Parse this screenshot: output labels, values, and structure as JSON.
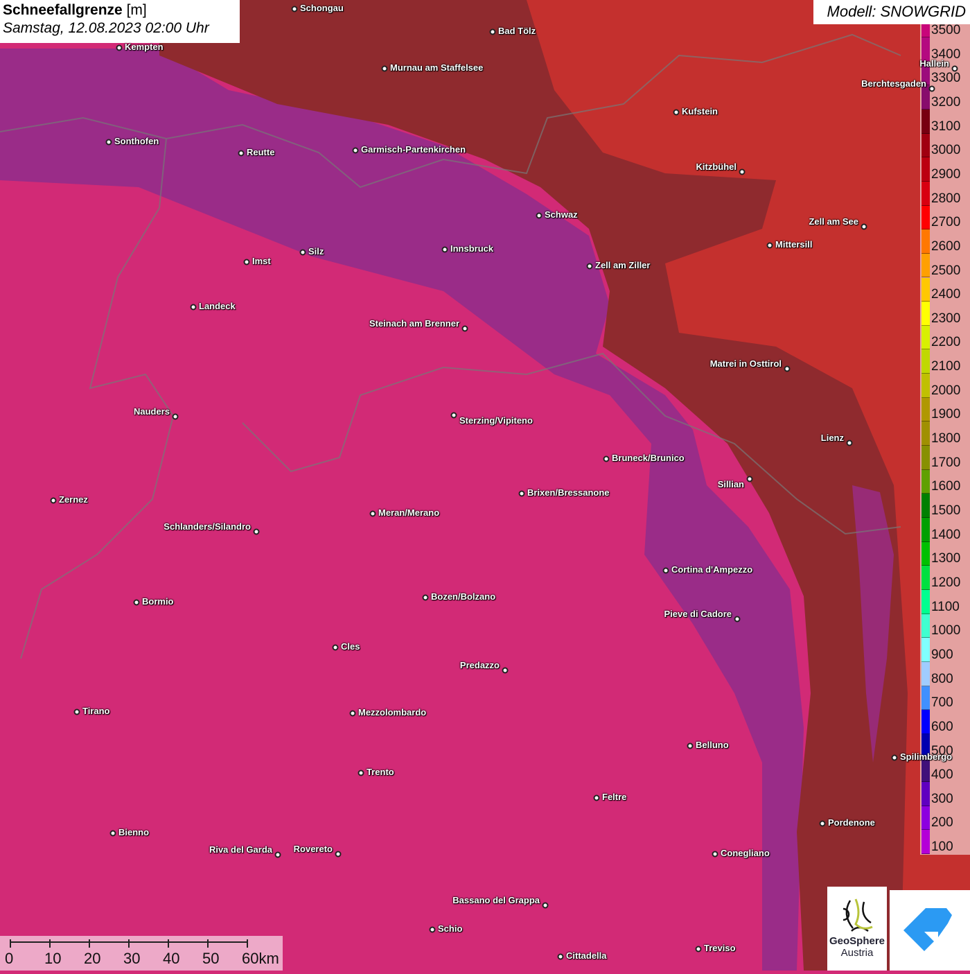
{
  "header": {
    "title": "Schneefallgrenze",
    "unit": "[m]",
    "datetime": "Samstag, 12.08.2023 02:00 Uhr"
  },
  "model_label": "Modell: SNOWGRID",
  "legend": {
    "labels": [
      "3500",
      "3400",
      "3300",
      "3200",
      "3100",
      "3000",
      "2900",
      "2800",
      "2700",
      "2600",
      "2500",
      "2400",
      "2300",
      "2200",
      "2100",
      "2000",
      "1900",
      "1800",
      "1700",
      "1600",
      "1500",
      "1400",
      "1300",
      "1200",
      "1100",
      "1000",
      "900",
      "800",
      "700",
      "600",
      "500",
      "400",
      "300",
      "200",
      "100"
    ],
    "colors": [
      "#c8067a",
      "#b40a80",
      "#9c0c7c",
      "#880c6c",
      "#780010",
      "#a00010",
      "#bc0010",
      "#d80010",
      "#ff0000",
      "#ff7800",
      "#ffa000",
      "#ffc800",
      "#ffff00",
      "#d8f000",
      "#c0d800",
      "#c0c000",
      "#b09800",
      "#a09000",
      "#889000",
      "#60a000",
      "#008000",
      "#00a000",
      "#00c000",
      "#00e040",
      "#00ff90",
      "#40ffd0",
      "#80ffff",
      "#a0ccff",
      "#4090ff",
      "#0000ff",
      "#0000b0",
      "#40107a",
      "#6000c0",
      "#8c00e0",
      "#b400d8"
    ]
  },
  "cities": [
    "Schongau",
    "Bad Tölz",
    "Kempten",
    "Murnau am Staffelsee",
    "Hallein",
    "Berchtesgaden",
    "Kufstein",
    "Sonthofen",
    "Reutte",
    "Garmisch-Partenkirchen",
    "Kitzbühel",
    "Schwaz",
    "Zell am See",
    "Mittersill",
    "Innsbruck",
    "Silz",
    "Imst",
    "Zell am Ziller",
    "Landeck",
    "Steinach am Brenner",
    "Matrei in Osttirol",
    "Nauders",
    "Sterzing/Vipiteno",
    "Lienz",
    "Bruneck/Brunico",
    "Sillian",
    "Brixen/Bressanone",
    "Zernez",
    "Meran/Merano",
    "Schlanders/Silandro",
    "Cortina d'Ampezzo",
    "Bozen/Bolzano",
    "Bormio",
    "Pieve di Cadore",
    "Cles",
    "Predazzo",
    "Tirano",
    "Mezzolombardo",
    "Belluno",
    "Spilimbergo",
    "Trento",
    "Feltre",
    "Pordenone",
    "Bienno",
    "Riva del Garda",
    "Rovereto",
    "Conegliano",
    "Bassano del Grappa",
    "Schio",
    "Treviso",
    "Cittadella"
  ],
  "scale": {
    "labels": [
      "0",
      "10",
      "20",
      "30",
      "40",
      "50",
      "60km"
    ]
  },
  "logos": {
    "geosphere_line1": "GeoSphere",
    "geosphere_line2": "Austria"
  }
}
